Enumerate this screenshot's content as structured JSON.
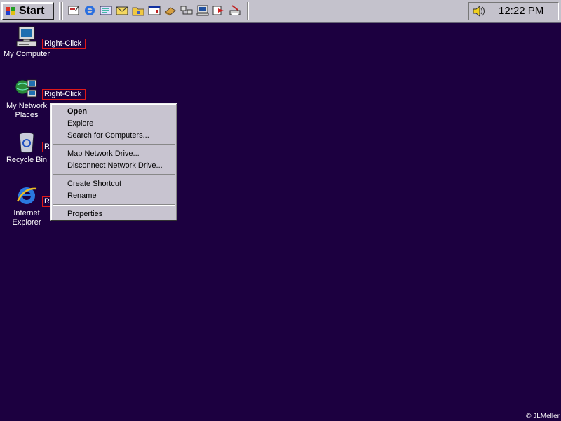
{
  "taskbar": {
    "start_label": "Start",
    "clock": "12:22 PM",
    "quick_launch": [
      "show-desktop-icon",
      "internet-explorer-icon",
      "channels-icon",
      "outlook-icon",
      "folder-icon",
      "window-icon",
      "book-icon",
      "network-icon",
      "computer-icon",
      "arrow-icon",
      "printer-icon"
    ]
  },
  "desktop": {
    "icons": [
      {
        "label": "My Computer"
      },
      {
        "label": "My Network Places"
      },
      {
        "label": "Recycle Bin"
      },
      {
        "label": "Internet Explorer"
      }
    ],
    "right_click_tags": [
      "Right-Click",
      "Right-Click",
      "Ri",
      "Ri"
    ]
  },
  "context_menu": {
    "items": [
      {
        "label": "Open",
        "bold": true
      },
      {
        "label": "Explore"
      },
      {
        "label": "Search for Computers..."
      },
      {
        "label": "Map Network Drive..."
      },
      {
        "label": "Disconnect Network Drive..."
      },
      {
        "label": "Create Shortcut"
      },
      {
        "label": "Rename"
      },
      {
        "label": "Properties"
      }
    ]
  },
  "copyright": "© JLMeller",
  "colors": {
    "desktop": "#1c0040",
    "taskbar": "#c4c2cc",
    "menu": "#c8c4d0",
    "tag_border": "#e01818"
  }
}
